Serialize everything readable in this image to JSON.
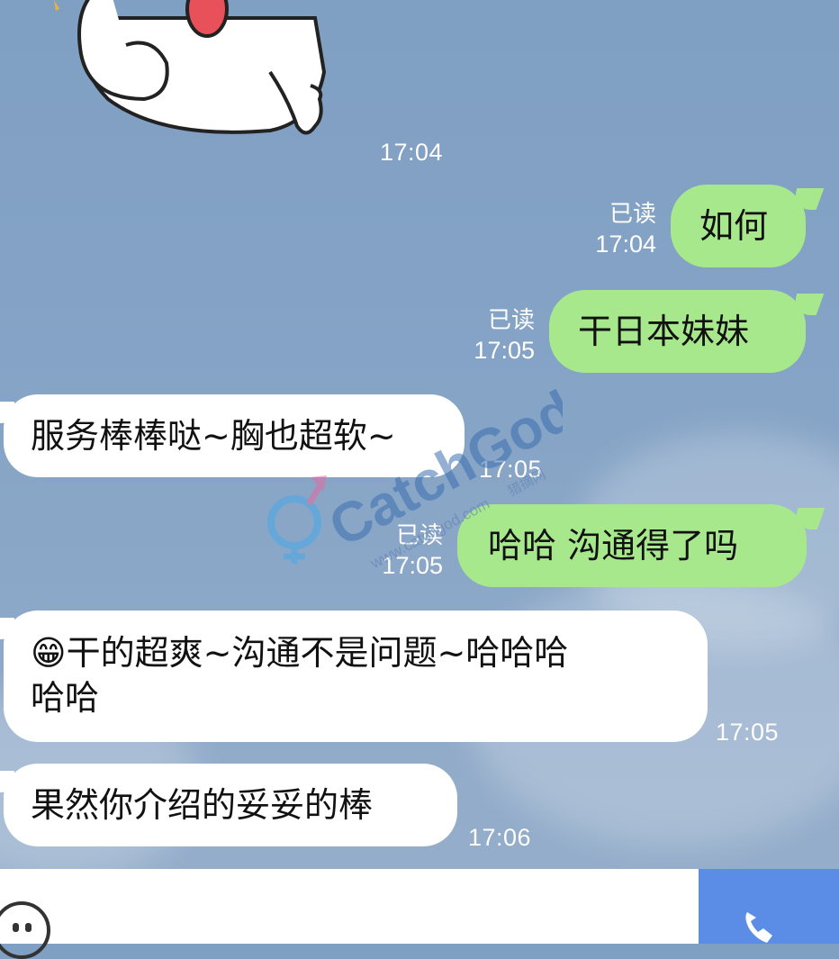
{
  "messages": {
    "sticker_time": "17:04",
    "m1": {
      "text": "如何",
      "read": "已读",
      "time": "17:04"
    },
    "m2": {
      "text": "干日本妹妹",
      "read": "已读",
      "time": "17:05"
    },
    "m3": {
      "text": "服务棒棒哒~胸也超软~",
      "time": "17:05"
    },
    "m4": {
      "text": "哈哈 沟通得了吗",
      "read": "已读",
      "time": "17:05"
    },
    "m5": {
      "emoji": "😁",
      "line1": "干的超爽~沟通不是问题~哈哈哈",
      "line2": "哈哈",
      "time": "17:05"
    },
    "m6": {
      "text": "果然你介绍的妥妥的棒",
      "time": "17:06"
    }
  },
  "watermark": {
    "brand": "CatchGod",
    "url": "www.catchgod.com",
    "cn": "猎摘网"
  },
  "input": {
    "emoji_icon": "smiley-icon",
    "call_icon": "phone-icon"
  },
  "colors": {
    "outgoing": "#a8e88d",
    "incoming": "#ffffff",
    "background": "#86a4c6",
    "call": "#5c8de6"
  }
}
